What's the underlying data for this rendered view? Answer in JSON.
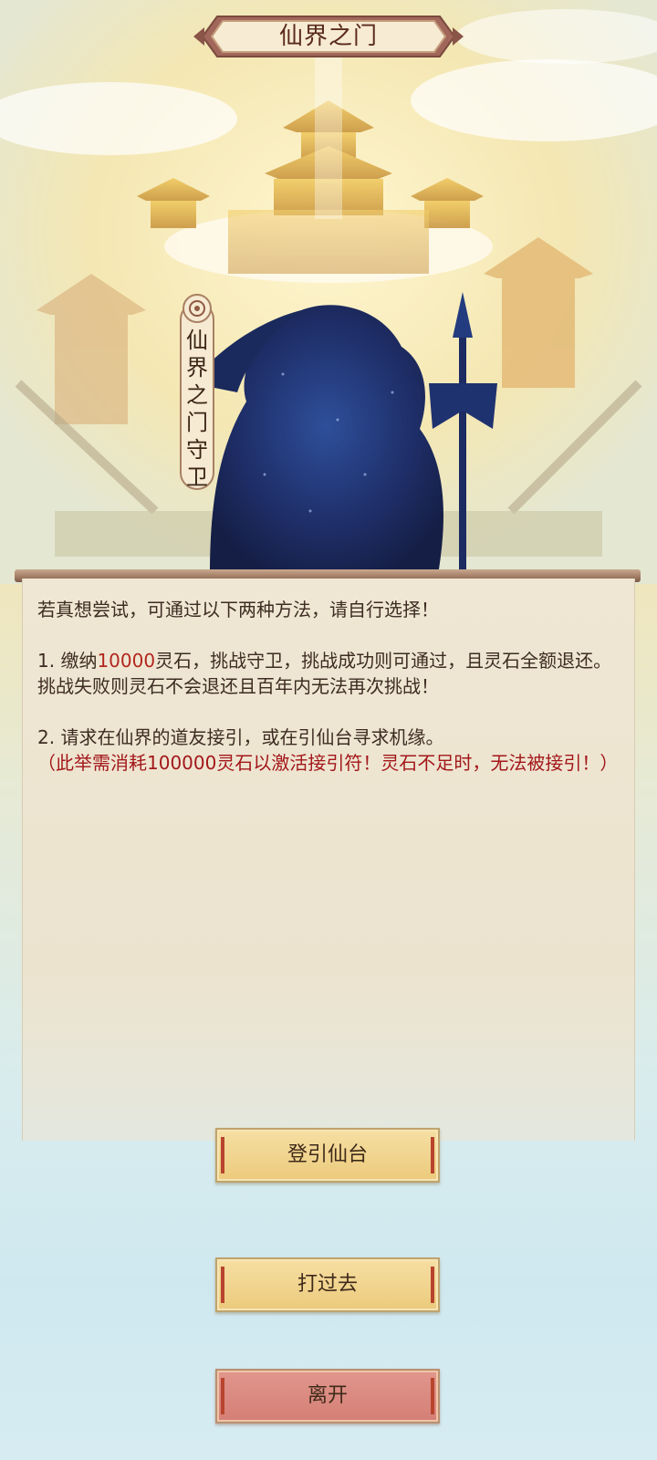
{
  "header": {
    "title": "仙界之门"
  },
  "guard": {
    "chars": [
      "仙",
      "界",
      "之",
      "门",
      "守",
      "卫"
    ]
  },
  "panel": {
    "intro": "若真想尝试，可通过以下两种方法，请自行选择！",
    "option1": {
      "prefix": "1. 缴纳",
      "amount": "10000",
      "suffix": "灵石，挑战守卫，挑战成功则可通过，且灵石全额退还。挑战失败则灵石不会退还且百年内无法再次挑战！"
    },
    "option2": {
      "text": "2. 请求在仙界的道友接引，或在引仙台寻求机缘。",
      "warning": "（此举需消耗100000灵石以激活接引符！灵石不足时，无法被接引！）"
    }
  },
  "buttons": {
    "ascend": "登引仙台",
    "fight": "打过去",
    "leave": "离开"
  },
  "colors": {
    "highlight": "#b3261e",
    "warning": "#a3171a",
    "button_gold": "#ecca7c",
    "button_red": "#d57f76"
  }
}
